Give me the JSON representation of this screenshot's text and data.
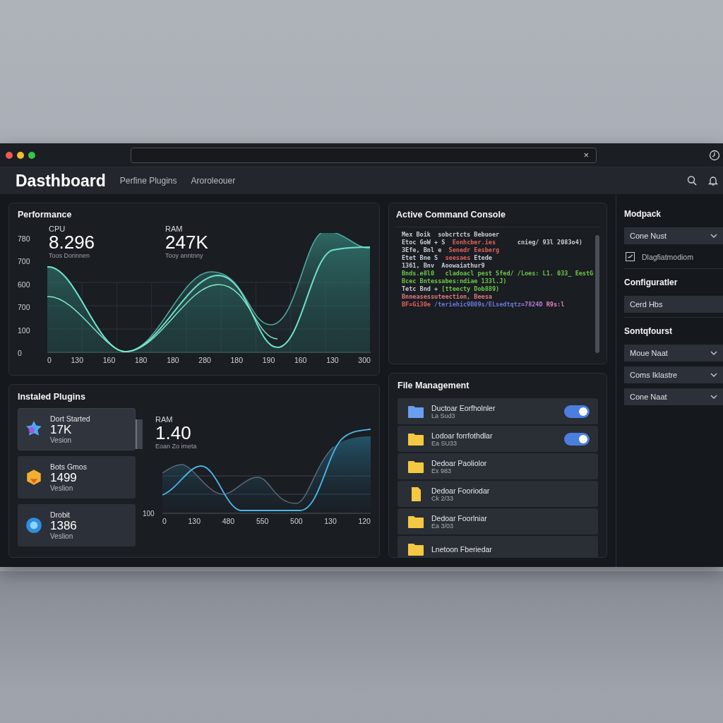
{
  "window": {
    "clear_icon": "×"
  },
  "header": {
    "title": "Dasthboard",
    "nav": [
      {
        "label": "Perfine Plugins",
        "selected": false
      },
      {
        "label": "Aroroleouer",
        "selected": false
      }
    ]
  },
  "performance": {
    "title": "Performance",
    "stats": [
      {
        "label": "CPU",
        "value": "8.296",
        "caption": "Toos Dorinnen"
      },
      {
        "label": "RAM",
        "value": "247K",
        "caption": "Tooy anntnny"
      }
    ],
    "y_labels": [
      "780",
      "700",
      "600",
      "700",
      "100",
      "0"
    ],
    "x_labels": [
      "0",
      "130",
      "160",
      "180",
      "180",
      "280",
      "180",
      "190",
      "160",
      "130",
      "300"
    ]
  },
  "plugins": {
    "title": "Instaled Plugins",
    "items": [
      {
        "name": "Dort Started",
        "value": "17K",
        "caption": "Vesion",
        "kind": "star",
        "selected": true
      },
      {
        "name": "Bots Gmos",
        "value": "1499",
        "caption": "Veslion",
        "kind": "hexagon",
        "selected": false
      },
      {
        "name": "Drobit",
        "value": "1386",
        "caption": "Veslion",
        "kind": "badge",
        "selected": false
      }
    ],
    "stat": {
      "label": "RAM",
      "value": "1.40",
      "caption": "Eoan Zo imeta"
    },
    "y_labels": [
      "100"
    ],
    "x_labels": [
      "0",
      "130",
      "480",
      "550",
      "500",
      "130",
      "120"
    ]
  },
  "console": {
    "title": "Active Command Console",
    "lines": [
      [
        {
          "text": "Mex Boik  sobcrtcts Bebuoer",
          "color": "#c9ccd2"
        }
      ],
      [
        {
          "text": "Etoc GoW + S  ",
          "color": "#c9ccd2"
        },
        {
          "text": "Eonhcber.ies",
          "color": "#e0605a"
        },
        {
          "text": "      cnieg/ 93l 2083o4)",
          "color": "#c9ccd2"
        }
      ],
      [
        {
          "text": "3Efe, Bnl e  ",
          "color": "#c9ccd2"
        },
        {
          "text": "Senedr Eesberg",
          "color": "#e0605a"
        }
      ],
      [
        {
          "text": "Etet Bne S  ",
          "color": "#c9ccd2"
        },
        {
          "text": "seesaes",
          "color": "#e0605a"
        },
        {
          "text": " Etede",
          "color": "#c9ccd2"
        }
      ],
      [
        {
          "text": "1361, Bnv  Aoowaiathur9",
          "color": "#c9ccd2"
        }
      ],
      [
        {
          "text": "Bnds.e8l0   cladoacl pest Sfed/ /Loes: L1. 033_ EestG",
          "color": "#6cc84a"
        }
      ],
      [
        {
          "text": "Bcec Bntessabes:ndiae 133l.J)",
          "color": "#6cc84a"
        }
      ],
      [
        {
          "text": "Tetc Bnd + ",
          "color": "#c9ccd2"
        },
        {
          "text": "[tteecty Dob889)",
          "color": "#6cc84a"
        }
      ],
      [
        {
          "text": "Bnneasessuteection, Beesa",
          "color": "#e07a7a"
        }
      ],
      [
        {
          "text": "BF=Gi30e ",
          "color": "#e0605a"
        },
        {
          "text": "/teriehic9B09s/ELsedtqtz",
          "color": "#6a78e0"
        },
        {
          "text": "=7824D ",
          "color": "#b07ad8"
        },
        {
          "text": "R9s:l",
          "color": "#e080c0"
        }
      ]
    ]
  },
  "files": {
    "title": "File Management",
    "rows": [
      {
        "name": "Ductoar Eorfholnler",
        "detail": "La Sud3",
        "kind": "folder",
        "color": "#6a9ef0",
        "on": true
      },
      {
        "name": "Lodoar forrfothdlar",
        "detail": "Ea SU33",
        "kind": "folder",
        "color": "#f5c842",
        "on": true
      },
      {
        "name": "Dedoar Paoliolor",
        "detail": "Ex 983",
        "kind": "folder",
        "color": "#f5c842"
      },
      {
        "name": "Dedoar Fooriodar",
        "detail": "Ck 2/33",
        "kind": "file",
        "color": "#f5c842"
      },
      {
        "name": "Dedoar Foorlniar",
        "detail": "Ea 3/03",
        "kind": "folder",
        "color": "#f5c842"
      },
      {
        "name": "Lnetoon Fberiedar",
        "kind": "folder",
        "color": "#f5c842"
      }
    ]
  },
  "sidebar": {
    "sections": [
      {
        "title": "Modpack",
        "controls": [
          {
            "kind": "select",
            "value": "Cone Nust"
          },
          {
            "kind": "checkbox",
            "label": "Dlagfiatmodiom",
            "checked": true
          }
        ]
      },
      {
        "title": "Configuratler",
        "controls": [
          {
            "kind": "field",
            "value": "Cerd Hbs"
          }
        ]
      },
      {
        "title": "Sontqfourst",
        "controls": [
          {
            "kind": "select",
            "value": "Moue Naat"
          },
          {
            "kind": "select",
            "value": "Coms Iklastre"
          },
          {
            "kind": "select",
            "value": "Cone Naat"
          }
        ]
      }
    ]
  }
}
